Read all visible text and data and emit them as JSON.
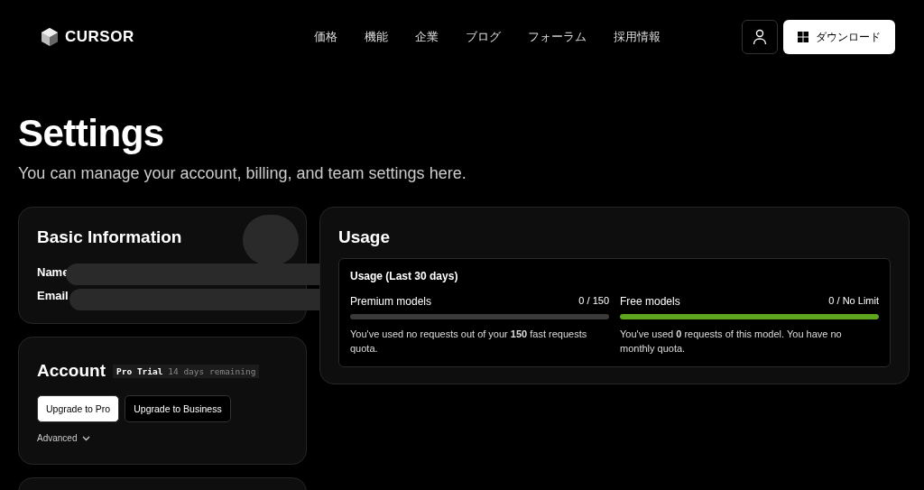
{
  "header": {
    "logo": "CURSOR",
    "nav": [
      "価格",
      "機能",
      "企業",
      "ブログ",
      "フォーラム",
      "採用情報"
    ],
    "download": "ダウンロード"
  },
  "page": {
    "title": "Settings",
    "subtitle": "You can manage your account, billing, and team settings here."
  },
  "basic_info": {
    "title": "Basic Information",
    "fields": [
      {
        "label": "Name"
      },
      {
        "label": "Email"
      }
    ]
  },
  "account": {
    "title": "Account",
    "plan": "Pro Trial",
    "remaining": "14 days remaining",
    "buttons": [
      {
        "label": "Upgrade to Pro",
        "kind": "primary"
      },
      {
        "label": "Upgrade to Business",
        "kind": "secondary"
      }
    ],
    "advanced": "Advanced"
  },
  "usage": {
    "title": "Usage",
    "box_title": "Usage (Last 30 days)",
    "meters": [
      {
        "name": "Premium models",
        "reading": "0 / 150",
        "level": 0,
        "note": "You've used no requests out of your **150** fast requests quota."
      },
      {
        "name": "Free models",
        "reading": "0 / No Limit",
        "level": 1,
        "note": "You've used **0** requests of this model. You have no monthly quota."
      }
    ]
  }
}
